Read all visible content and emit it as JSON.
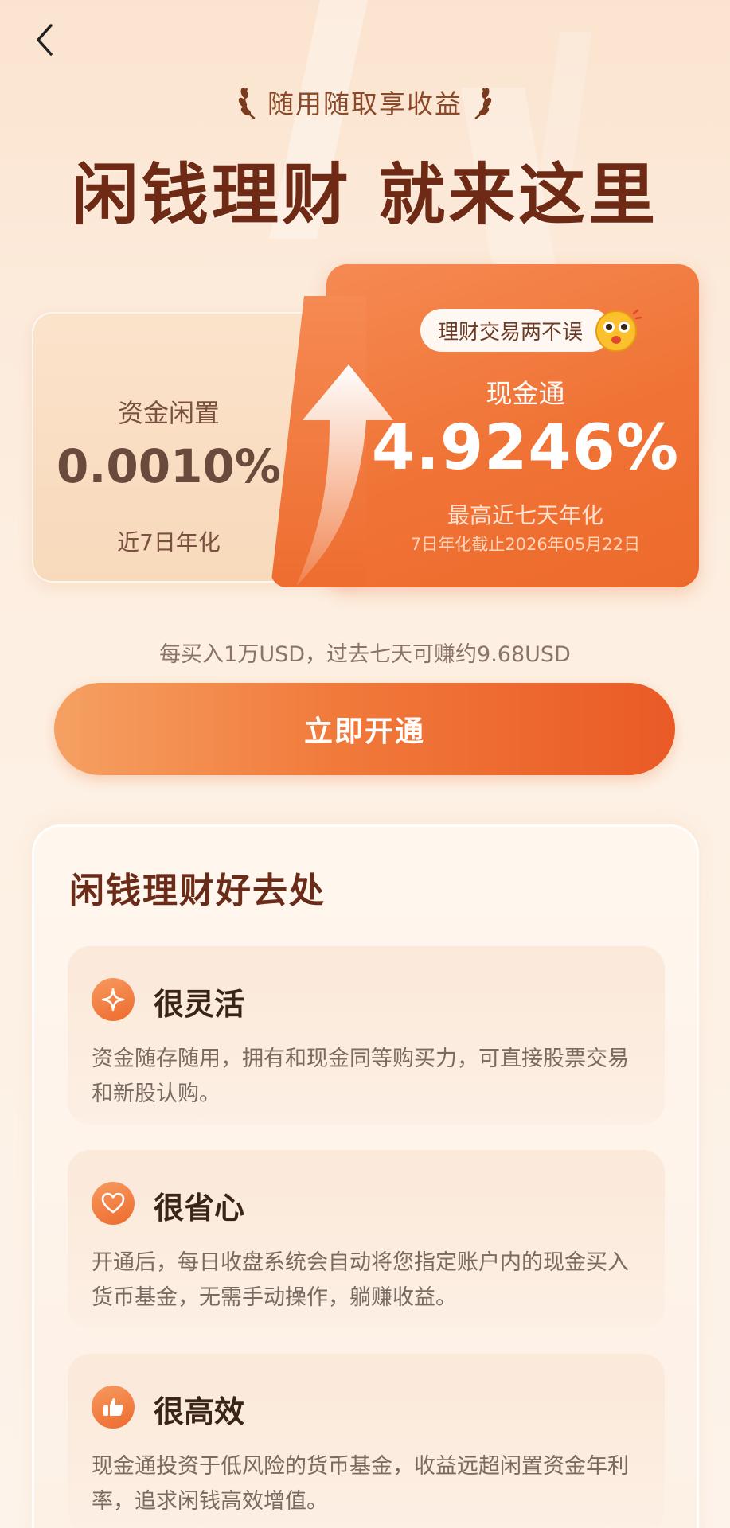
{
  "header": {
    "subtitle": "随用随取享收益",
    "title": "闲钱理财 就来这里"
  },
  "compare": {
    "idle": {
      "label": "资金闲置",
      "rate": "0.0010%",
      "note": "近7日年化"
    },
    "cash": {
      "tag": "理财交易两不误",
      "name": "现金通",
      "rate": "4.9246%",
      "note": "最高近七天年化",
      "date": "7日年化截止2026年05月22日"
    }
  },
  "earn_note": "每买入1万USD，过去七天可赚约9.68USD",
  "cta_label": "立即开通",
  "benefits": {
    "title": "闲钱理财好去处",
    "items": [
      {
        "icon": "sparkle-icon",
        "title": "很灵活",
        "desc": "资金随存随用，拥有和现金同等购买力，可直接股票交易和新股认购。"
      },
      {
        "icon": "heart-icon",
        "title": "很省心",
        "desc": "开通后，每日收盘系统会自动将您指定账户内的现金买入货币基金，无需手动操作，躺赚收益。"
      },
      {
        "icon": "thumbs-up-icon",
        "title": "很高效",
        "desc": "现金通投资于低风险的货币基金，收益远超闲置资金年利率，追求闲钱高效增值。"
      }
    ]
  },
  "colors": {
    "accent": "#F07335",
    "title": "#6E2A14",
    "background": "#FCEBDC"
  }
}
